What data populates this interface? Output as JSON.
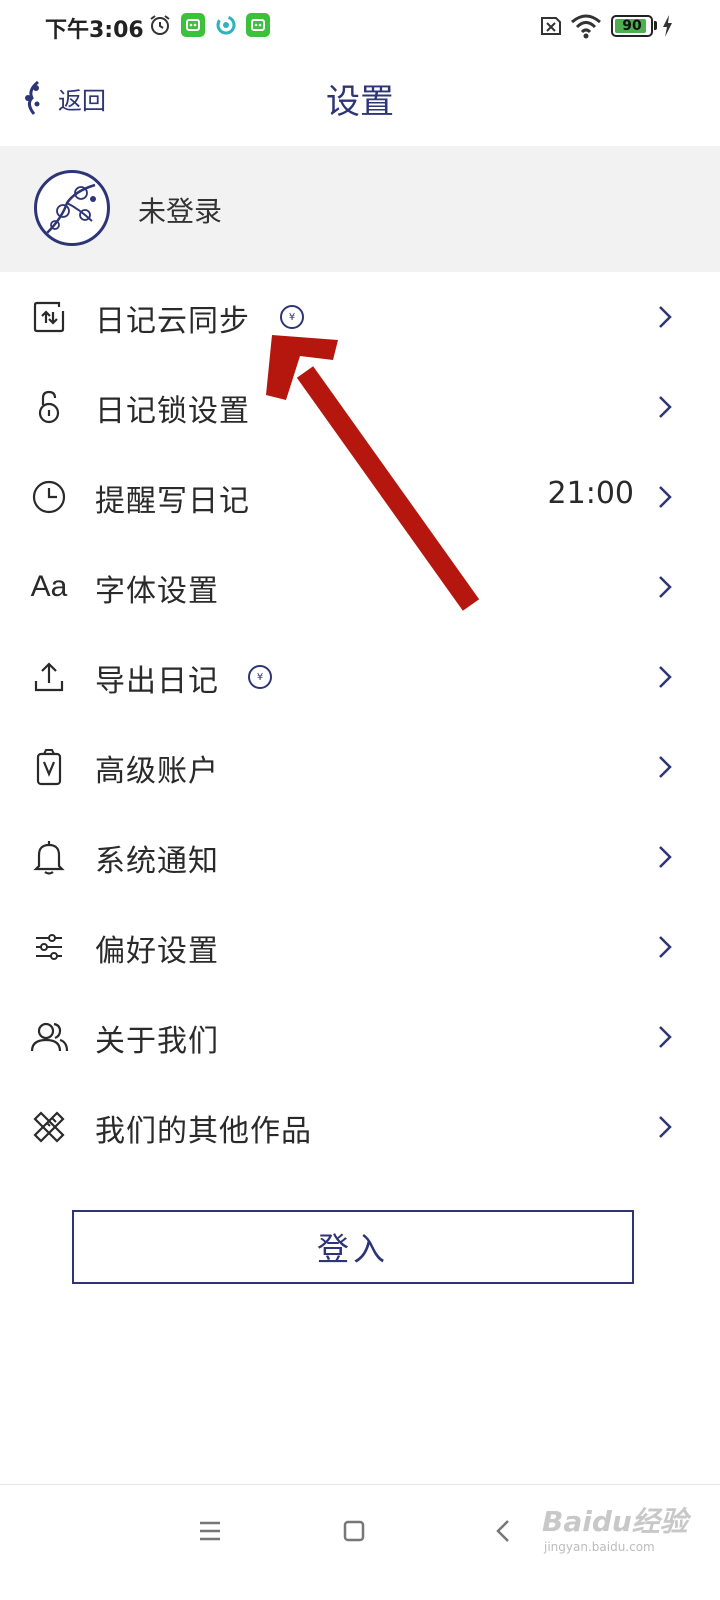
{
  "status_bar": {
    "time": "下午3:06",
    "battery": "90"
  },
  "nav": {
    "back_label": "返回",
    "title": "设置"
  },
  "profile": {
    "name": "未登录"
  },
  "menu": [
    {
      "label": "日记云同步",
      "icon": "cloud-sync-icon",
      "badge": "¥",
      "value": ""
    },
    {
      "label": "日记锁设置",
      "icon": "lock-icon",
      "badge": "",
      "value": ""
    },
    {
      "label": "提醒写日记",
      "icon": "clock-icon",
      "badge": "",
      "value": "21:00"
    },
    {
      "label": "字体设置",
      "icon": "font-icon",
      "glyph": "Aa",
      "badge": "",
      "value": ""
    },
    {
      "label": "导出日记",
      "icon": "export-icon",
      "badge": "¥",
      "value": ""
    },
    {
      "label": "高级账户",
      "icon": "premium-account-icon",
      "badge": "",
      "value": ""
    },
    {
      "label": "系统通知",
      "icon": "bell-icon",
      "badge": "",
      "value": ""
    },
    {
      "label": "偏好设置",
      "icon": "sliders-icon",
      "badge": "",
      "value": ""
    },
    {
      "label": "关于我们",
      "icon": "people-icon",
      "badge": "",
      "value": ""
    },
    {
      "label": "我们的其他作品",
      "icon": "design-tools-icon",
      "badge": "",
      "value": ""
    }
  ],
  "login_button": "登入",
  "watermark": {
    "logo": "Baidu经验",
    "url": "jingyan.baidu.com"
  },
  "colors": {
    "accent": "#2e3576",
    "profile_bg": "#f2f2f2",
    "annotation_arrow": "#b5170f"
  }
}
